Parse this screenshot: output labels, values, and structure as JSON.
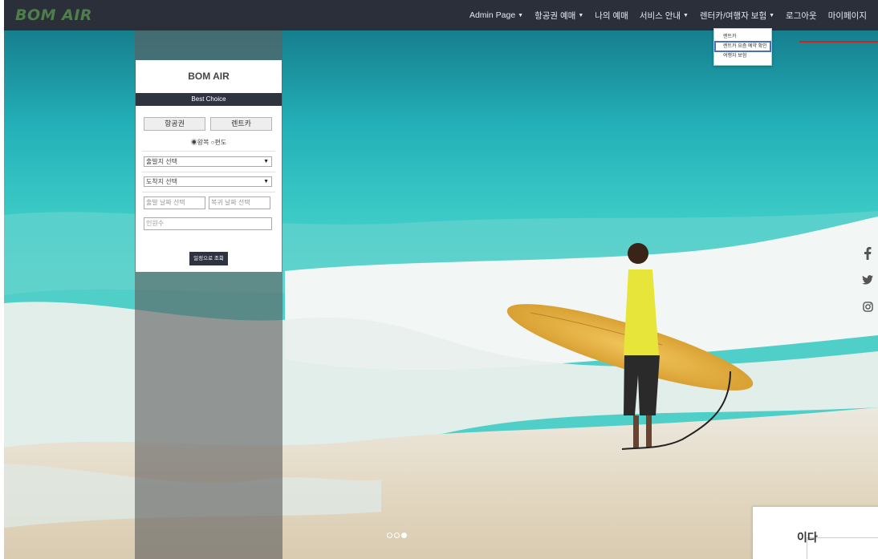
{
  "brand": "BOM AIR",
  "nav": [
    {
      "label": "Admin Page",
      "caret": true
    },
    {
      "label": "항공권 예매",
      "caret": true
    },
    {
      "label": "나의 예매",
      "caret": false
    },
    {
      "label": "서비스 안내",
      "caret": true
    },
    {
      "label": "렌터카/여행자 보험",
      "caret": true
    },
    {
      "label": "로그아웃",
      "caret": false
    },
    {
      "label": "마이페이지",
      "caret": false
    }
  ],
  "dropdown": {
    "items": [
      "렌트카",
      "렌트카 요즘 예약 확인",
      "여행자 보험"
    ],
    "active_index": 1
  },
  "panel": {
    "title": "BOM AIR",
    "subtitle": "Best Choice",
    "tab_flight": "항공권",
    "tab_rent": "렌트카",
    "trip_type": "◉왕복 ○편도",
    "depart_select": "출발지 선택",
    "arrive_select": "도착지 선택",
    "date_depart_placeholder": "출발 날짜 선택",
    "date_return_placeholder": "복귀 날짜 선택",
    "people_placeholder": "인원수",
    "search_button": "일정으로 조회"
  },
  "social_icons": [
    "facebook-icon",
    "twitter-icon",
    "instagram-icon"
  ],
  "carousel": {
    "total": 3,
    "active": 3
  },
  "popup": {
    "text": "이다"
  },
  "colors": {
    "navbar": "#2b2f3a",
    "brand": "#4e7f4a",
    "panel_bar": "#2f3340",
    "highlight": "#4d6fb6",
    "red_line": "#d22020"
  }
}
